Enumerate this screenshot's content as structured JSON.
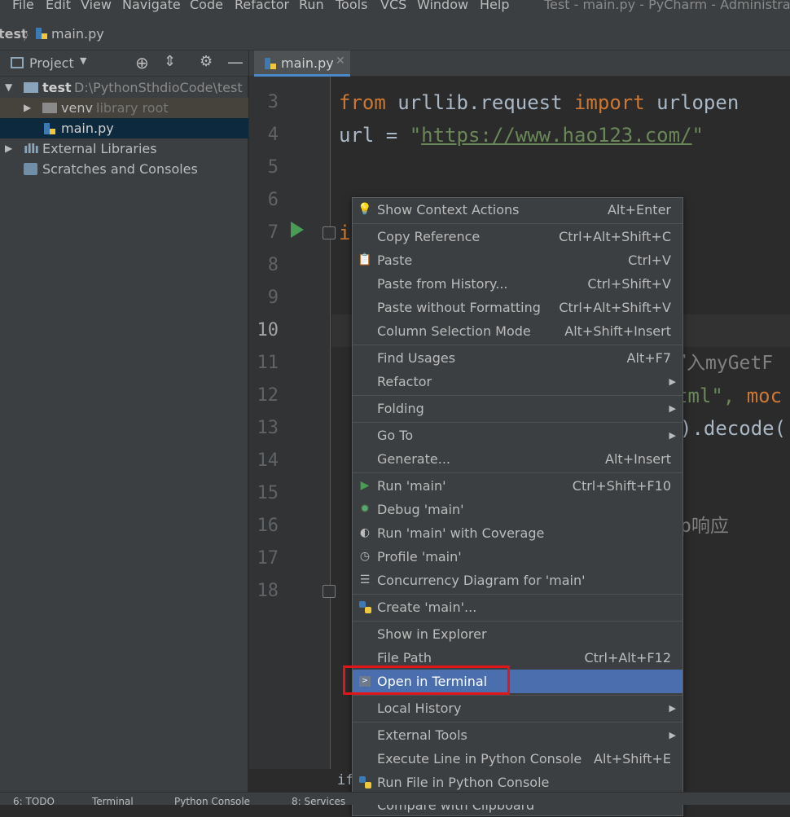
{
  "menubar": {
    "items": [
      "File",
      "Edit",
      "View",
      "Navigate",
      "Code",
      "Refactor",
      "Run",
      "Tools",
      "VCS",
      "Window",
      "Help"
    ],
    "window_title": "Test - main.py - PyCharm - Administrato"
  },
  "navbar": {
    "project": "test",
    "file": "main.py"
  },
  "project_panel": {
    "title": "Project",
    "tree": {
      "root_name": "test",
      "root_path": "D:\\PythonSthdioCode\\test",
      "venv_name": "venv",
      "venv_note": "library root",
      "file": "main.py",
      "external_libraries": "External Libraries",
      "scratches": "Scratches and Consoles"
    }
  },
  "editor": {
    "tab": "main.py",
    "line_numbers": [
      "3",
      "4",
      "5",
      "6",
      "7",
      "8",
      "9",
      "10",
      "11",
      "12",
      "13",
      "14",
      "15",
      "16",
      "17",
      "18"
    ],
    "code": {
      "l3_from": "from",
      "l3_mod": " urllib.request ",
      "l3_import": "import",
      "l3_name": " urlopen",
      "l4_pre": "url = ",
      "l4_q1": "\"",
      "l4_url": "https://www.hao123.com/",
      "l4_q2": "\"",
      "l7": "i",
      "l11": "写入myGetF",
      "l12_str": "tml\", ",
      "l12_kw": "moc",
      "l13": ").decode(",
      "l16": "p响应",
      "bottom": "if _"
    }
  },
  "context_menu": {
    "items": [
      {
        "label": "Show Context Actions",
        "shortcut": "Alt+Enter"
      },
      {
        "label": "Copy Reference",
        "shortcut": "Ctrl+Alt+Shift+C"
      },
      {
        "label": "Paste",
        "shortcut": "Ctrl+V"
      },
      {
        "label": "Paste from History...",
        "shortcut": "Ctrl+Shift+V"
      },
      {
        "label": "Paste without Formatting",
        "shortcut": "Ctrl+Alt+Shift+V"
      },
      {
        "label": "Column Selection Mode",
        "shortcut": "Alt+Shift+Insert"
      },
      {
        "label": "Find Usages",
        "shortcut": "Alt+F7"
      },
      {
        "label": "Refactor",
        "shortcut": ""
      },
      {
        "label": "Folding",
        "shortcut": ""
      },
      {
        "label": "Go To",
        "shortcut": ""
      },
      {
        "label": "Generate...",
        "shortcut": "Alt+Insert"
      },
      {
        "label": "Run 'main'",
        "shortcut": "Ctrl+Shift+F10"
      },
      {
        "label": "Debug 'main'",
        "shortcut": ""
      },
      {
        "label": "Run 'main' with Coverage",
        "shortcut": ""
      },
      {
        "label": "Profile 'main'",
        "shortcut": ""
      },
      {
        "label": "Concurrency Diagram for 'main'",
        "shortcut": ""
      },
      {
        "label": "Create 'main'...",
        "shortcut": ""
      },
      {
        "label": "Show in Explorer",
        "shortcut": ""
      },
      {
        "label": "File Path",
        "shortcut": "Ctrl+Alt+F12"
      },
      {
        "label": "Open in Terminal",
        "shortcut": ""
      },
      {
        "label": "Local History",
        "shortcut": ""
      },
      {
        "label": "External Tools",
        "shortcut": ""
      },
      {
        "label": "Execute Line in Python Console",
        "shortcut": "Alt+Shift+E"
      },
      {
        "label": "Run File in Python Console",
        "shortcut": ""
      },
      {
        "label": "Compare with Clipboard",
        "shortcut": ""
      }
    ]
  },
  "statusbar": {
    "items": [
      "6: TODO",
      "Terminal",
      "Python Console",
      "8: Services"
    ]
  }
}
